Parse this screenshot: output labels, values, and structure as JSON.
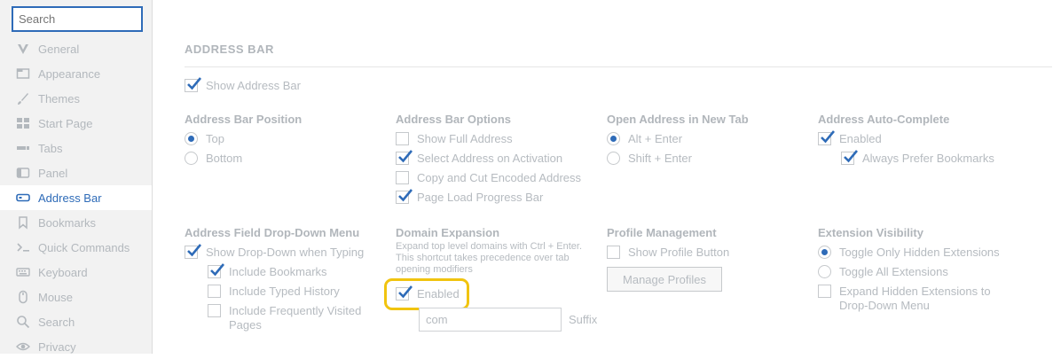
{
  "sidebar": {
    "search_placeholder": "Search",
    "items": [
      {
        "label": "General",
        "icon": "v-logo-icon"
      },
      {
        "label": "Appearance",
        "icon": "window-icon"
      },
      {
        "label": "Themes",
        "icon": "brush-icon"
      },
      {
        "label": "Start Page",
        "icon": "grid-icon"
      },
      {
        "label": "Tabs",
        "icon": "tabs-icon"
      },
      {
        "label": "Panel",
        "icon": "panel-icon"
      },
      {
        "label": "Address Bar",
        "icon": "address-bar-icon",
        "active": true
      },
      {
        "label": "Bookmarks",
        "icon": "bookmark-icon"
      },
      {
        "label": "Quick Commands",
        "icon": "terminal-icon"
      },
      {
        "label": "Keyboard",
        "icon": "keyboard-icon"
      },
      {
        "label": "Mouse",
        "icon": "mouse-icon"
      },
      {
        "label": "Search",
        "icon": "search-icon"
      },
      {
        "label": "Privacy",
        "icon": "eye-icon"
      }
    ]
  },
  "main": {
    "section_title": "ADDRESS BAR",
    "show_address_bar": {
      "label": "Show Address Bar",
      "checked": true
    },
    "position": {
      "title": "Address Bar Position",
      "options": [
        {
          "label": "Top",
          "selected": true
        },
        {
          "label": "Bottom",
          "selected": false
        }
      ]
    },
    "options": {
      "title": "Address Bar Options",
      "items": [
        {
          "label": "Show Full Address",
          "checked": false
        },
        {
          "label": "Select Address on Activation",
          "checked": true
        },
        {
          "label": "Copy and Cut Encoded Address",
          "checked": false
        },
        {
          "label": "Page Load Progress Bar",
          "checked": true
        }
      ]
    },
    "open_new_tab": {
      "title": "Open Address in New Tab",
      "options": [
        {
          "label": "Alt + Enter",
          "selected": true
        },
        {
          "label": "Shift + Enter",
          "selected": false
        }
      ]
    },
    "autocomplete": {
      "title": "Address Auto-Complete",
      "enabled": {
        "label": "Enabled",
        "checked": true
      },
      "prefer_bookmarks": {
        "label": "Always Prefer Bookmarks",
        "checked": true
      }
    },
    "dropdown": {
      "title": "Address Field Drop-Down Menu",
      "show": {
        "label": "Show Drop-Down when Typing",
        "checked": true
      },
      "items": [
        {
          "label": "Include Bookmarks",
          "checked": true
        },
        {
          "label": "Include Typed History",
          "checked": false
        },
        {
          "label": "Include Frequently Visited Pages",
          "checked": false
        }
      ]
    },
    "domain": {
      "title": "Domain Expansion",
      "description": "Expand top level domains with Ctrl + Enter. This shortcut takes precedence over tab opening modifiers",
      "enabled": {
        "label": "Enabled",
        "checked": true
      },
      "suffix_value": "com",
      "suffix_label": "Suffix"
    },
    "profile": {
      "title": "Profile Management",
      "show_button": {
        "label": "Show Profile Button",
        "checked": false
      },
      "manage_label": "Manage Profiles"
    },
    "extensions": {
      "title": "Extension Visibility",
      "options": [
        {
          "label": "Toggle Only Hidden Extensions",
          "selected": true
        },
        {
          "label": "Toggle All Extensions",
          "selected": false
        }
      ],
      "expand": {
        "label": "Expand Hidden Extensions to Drop-Down Menu",
        "checked": false
      }
    }
  },
  "colors": {
    "accent": "#2e6bb8",
    "highlight": "#f1c40f"
  }
}
